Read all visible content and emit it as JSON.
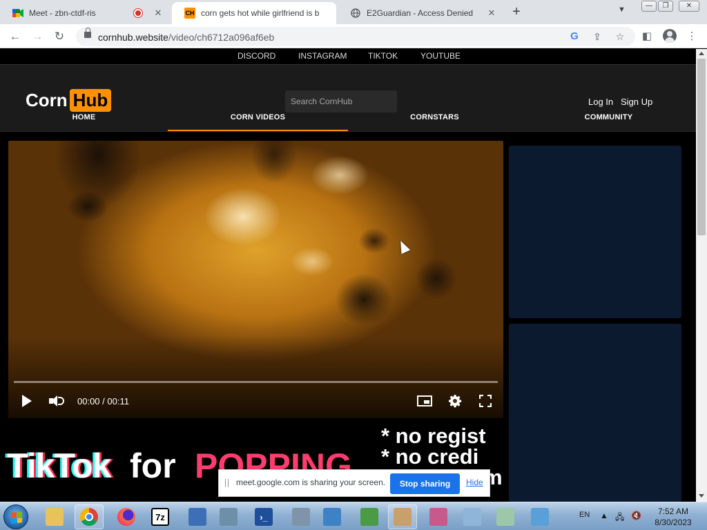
{
  "browser": {
    "tabs": [
      {
        "title": "Meet - zbn-ctdf-ris",
        "active": false,
        "recording": true
      },
      {
        "title": "corn gets hot while girlfriend is b",
        "active": true,
        "favicon_text": "CH"
      },
      {
        "title": "E2Guardian - Access Denied",
        "active": false
      }
    ],
    "url_host": "cornhub.website",
    "url_path": "/video/ch6712a096af6eb"
  },
  "site": {
    "social_links": [
      "DISCORD",
      "INSTAGRAM",
      "TIKTOK",
      "YOUTUBE"
    ],
    "logo": {
      "left": "Corn",
      "right": "Hub",
      "color": "#ff9000"
    },
    "search_placeholder": "Search CornHub",
    "login_label": "Log In",
    "signup_label": "Sign Up",
    "nav": [
      "HOME",
      "CORN VIDEOS",
      "CORNSTARS",
      "COMMUNITY"
    ],
    "active_nav": "CORN VIDEOS"
  },
  "video": {
    "time_label": "00:00 / 00:11",
    "progress_fraction": 0.0
  },
  "banner": {
    "word1": "TikTok",
    "word2": "for",
    "word3": "POPPING",
    "bullets": [
      "* no regist",
      "* no credi",
      "m"
    ]
  },
  "share_bar": {
    "message": "meet.google.com is sharing your screen.",
    "stop_label": "Stop sharing",
    "hide_label": "Hide"
  },
  "taskbar": {
    "language": "EN",
    "time": "7:52 AM",
    "date": "8/30/2023",
    "app_7zip_label": "7z"
  }
}
